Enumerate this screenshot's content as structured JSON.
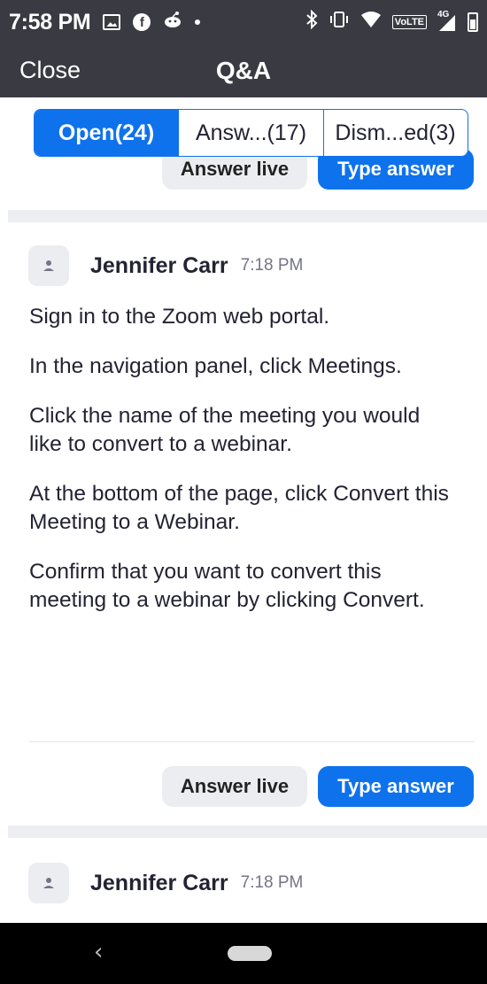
{
  "status_bar": {
    "time": "7:58 PM",
    "volte": "VoLTE",
    "network": "4G",
    "icons": [
      "image-icon",
      "facebook-icon",
      "reddit-icon",
      "dot-icon",
      "bluetooth-icon",
      "vibrate-icon",
      "wifi-icon",
      "volte-icon",
      "signal-icon",
      "battery-icon"
    ]
  },
  "header": {
    "close_label": "Close",
    "title": "Q&A"
  },
  "tabs": [
    {
      "label": "Open(24)",
      "active": true
    },
    {
      "label": "Answ...(17)",
      "active": false
    },
    {
      "label": "Dism...ed(3)",
      "active": false
    }
  ],
  "top_actions": {
    "answer_live": "Answer live",
    "type_answer": "Type answer"
  },
  "question_1": {
    "author": "Jennifer Carr",
    "time": "7:18 PM",
    "paragraphs": [
      "Sign in to the Zoom web portal.",
      "In the navigation panel, click Meetings.",
      "Click the name of the meeting you would like to convert to a webinar.",
      "At the bottom of the page, click Convert this Meeting to a Webinar.",
      "Confirm that you want to convert this meeting to a webinar by clicking Convert."
    ],
    "answer_live": "Answer live",
    "type_answer": "Type answer"
  },
  "question_2": {
    "author": "Jennifer Carr",
    "time": "7:18 PM"
  },
  "colors": {
    "header_bg": "#3a3a42",
    "accent": "#0e72ed",
    "secondary_button_bg": "#ecedf1",
    "separator": "#eceef1"
  }
}
